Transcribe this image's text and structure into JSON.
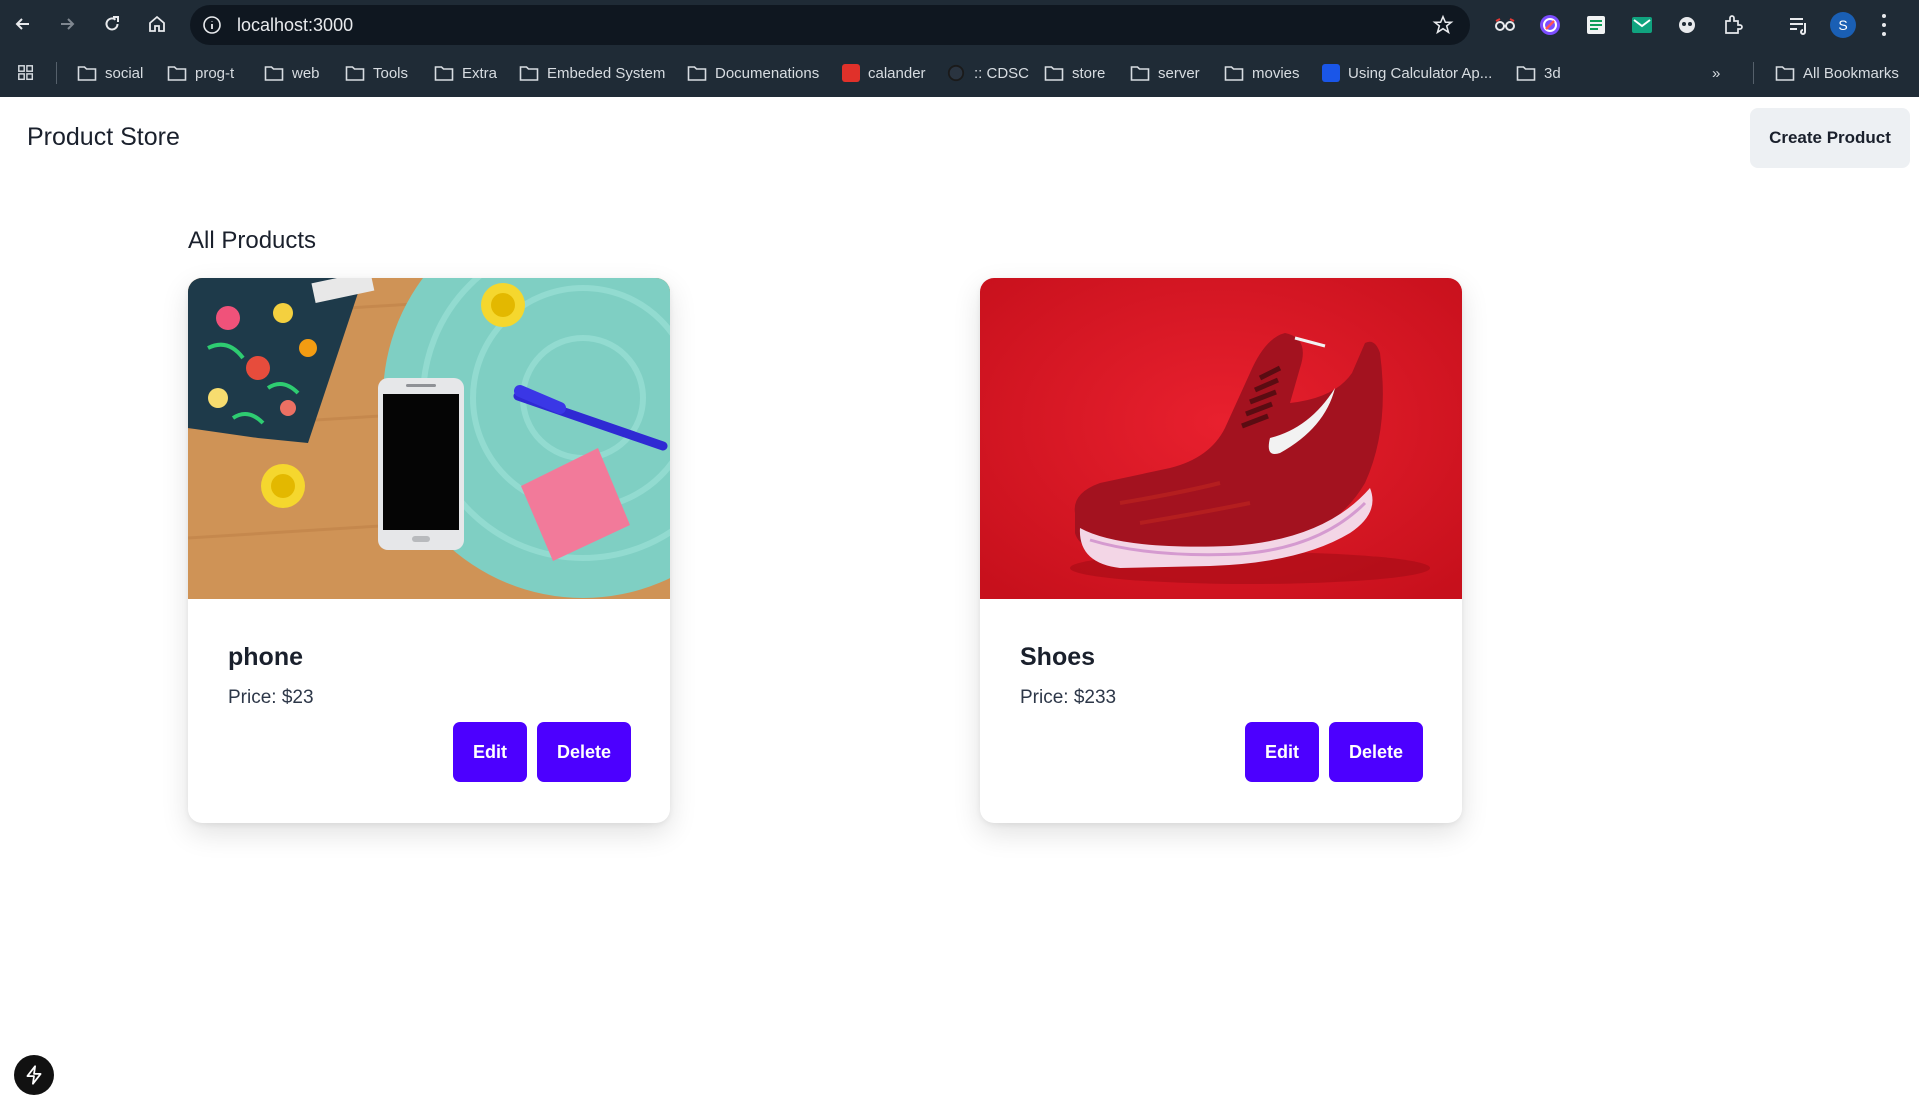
{
  "browser": {
    "url": "localhost:3000",
    "avatar_letter": "S",
    "bookmarks": [
      {
        "label": "social",
        "icon": "folder-icon"
      },
      {
        "label": "prog-t",
        "icon": "folder-icon"
      },
      {
        "label": "web",
        "icon": "folder-icon"
      },
      {
        "label": "Tools",
        "icon": "folder-icon"
      },
      {
        "label": "Extra",
        "icon": "folder-icon"
      },
      {
        "label": "Embeded System",
        "icon": "folder-icon"
      },
      {
        "label": "Documenations",
        "icon": "folder-icon"
      },
      {
        "label": "calander",
        "icon": "calendar-icon"
      },
      {
        "label": ":: CDSC",
        "icon": "site-icon"
      },
      {
        "label": "store",
        "icon": "folder-icon"
      },
      {
        "label": "server",
        "icon": "folder-icon"
      },
      {
        "label": "movies",
        "icon": "folder-icon"
      },
      {
        "label": "Using Calculator Ap...",
        "icon": "calculator-icon"
      },
      {
        "label": "3d",
        "icon": "folder-icon"
      }
    ],
    "overflow_label": "»",
    "all_bookmarks_label": "All Bookmarks"
  },
  "header": {
    "title": "Product Store",
    "create_label": "Create Product"
  },
  "main": {
    "section_title": "All Products",
    "products": [
      {
        "name": "phone",
        "price": "Price: $23",
        "edit_label": "Edit",
        "delete_label": "Delete"
      },
      {
        "name": "Shoes",
        "price": "Price: $233",
        "edit_label": "Edit",
        "delete_label": "Delete"
      }
    ]
  },
  "colors": {
    "primary_button": "#4c00ff",
    "chrome_bg": "#1f2b36",
    "page_bg": "#ffffff"
  }
}
